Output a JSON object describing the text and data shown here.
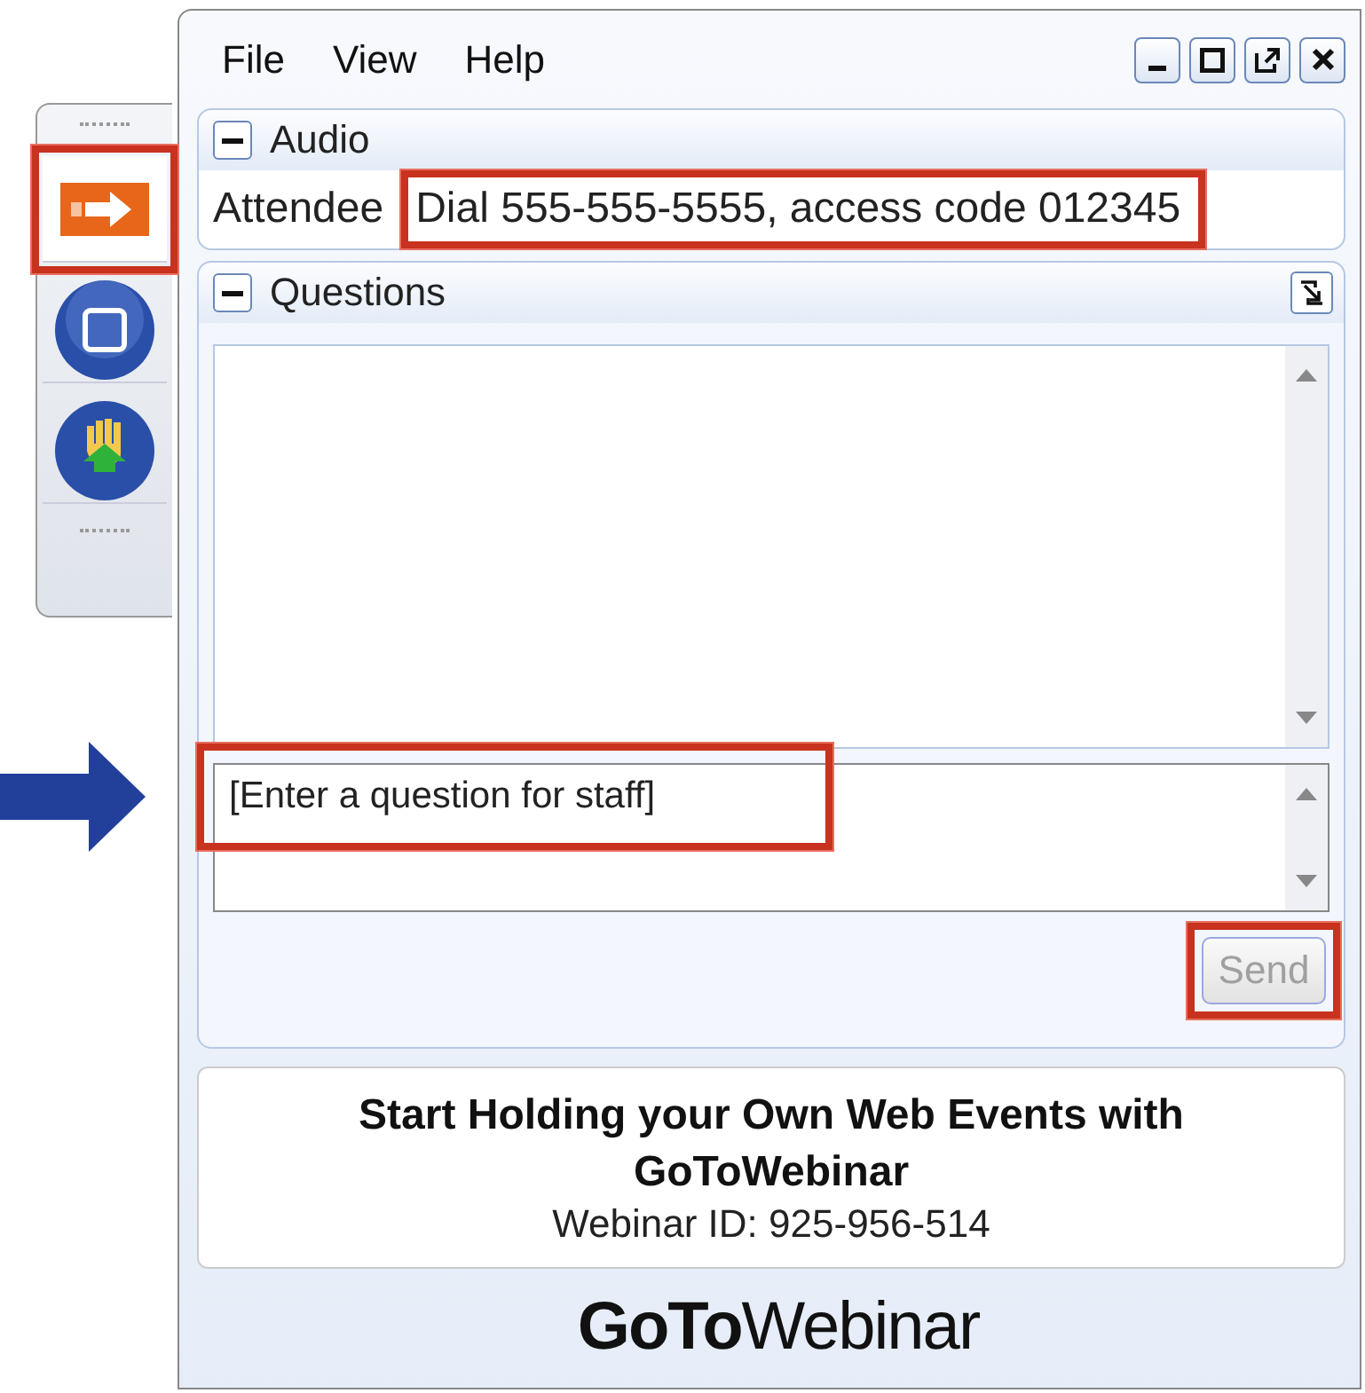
{
  "menu": [
    "File",
    "View",
    "Help"
  ],
  "window_controls": [
    {
      "kind": "minimize"
    },
    {
      "kind": "maximize"
    },
    {
      "kind": "popout"
    },
    {
      "kind": "close"
    }
  ],
  "toolbar": [
    {
      "kind": "screen",
      "selected": true
    },
    {
      "kind": "stop",
      "selected": false
    },
    {
      "kind": "hand",
      "selected": false
    }
  ],
  "audio": {
    "title": "Audio",
    "expanded": true,
    "label": "Attendee",
    "value": "Dial 555-555-5555, access code 012345"
  },
  "questions": {
    "title": "Questions",
    "expanded": true,
    "placeholder": "[Enter a question for staff]",
    "send": {
      "label": "Send",
      "disabled": true
    }
  },
  "promo": {
    "headline": "Start Holding your Own Web Events with GoToWebinar",
    "webinar_id": "Webinar ID: 925-956-514"
  },
  "logo": "**GoTo**Webinar"
}
